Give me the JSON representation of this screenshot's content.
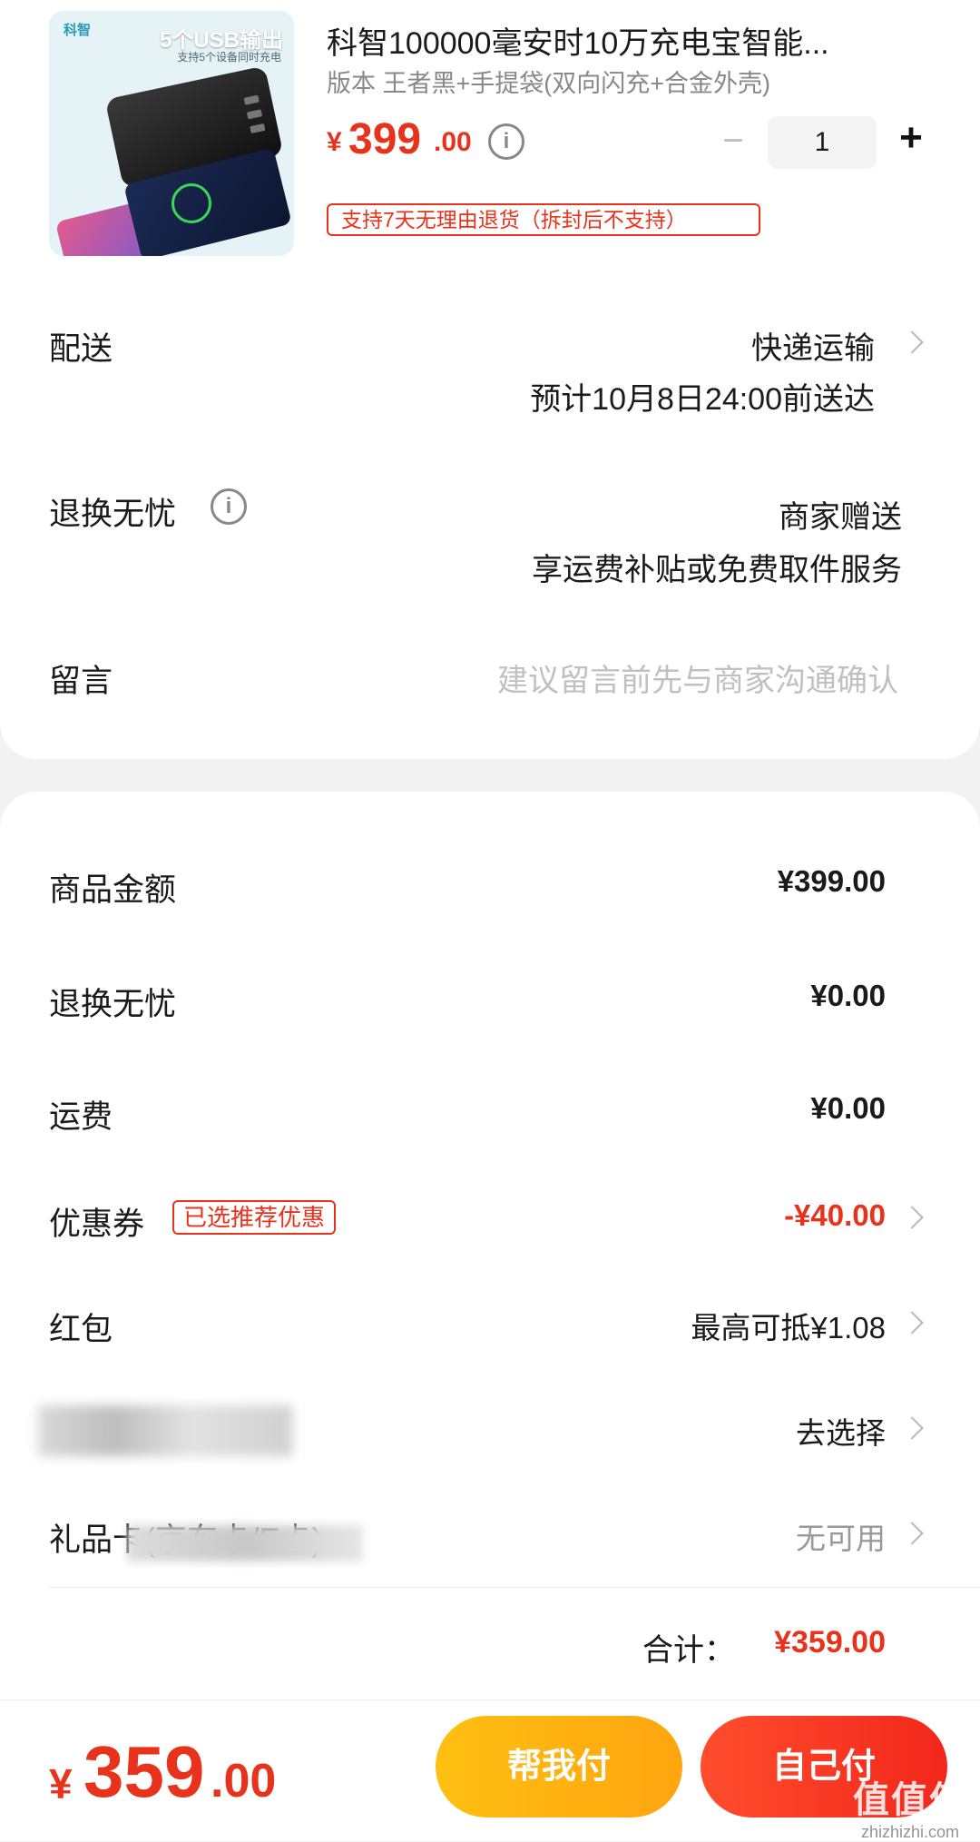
{
  "product": {
    "image_headline": "5个USB输出",
    "image_subline": "支持5个设备同时充电",
    "image_brand": "科智",
    "title": "科智100000毫安时10万充电宝智能...",
    "spec": "版本 王者黑+手提袋(双向闪充+合金外壳)",
    "price_symbol": "¥",
    "price_integer": "399",
    "price_decimal": ".00",
    "quantity": "1",
    "return_tag": "支持7天无理由退货（拆封后不支持）"
  },
  "delivery": {
    "label": "配送",
    "method": "快递运输",
    "eta": "预计10月8日24:00前送达"
  },
  "return_worry": {
    "label": "退换无忧",
    "line1": "商家赠送",
    "line2": "享运费补贴或免费取件服务"
  },
  "message": {
    "label": "留言",
    "placeholder": "建议留言前先与商家沟通确认"
  },
  "summary": {
    "goods_label": "商品金额",
    "goods_value": "¥399.00",
    "return_label": "退换无忧",
    "return_value": "¥0.00",
    "shipping_label": "运费",
    "shipping_value": "¥0.00",
    "coupon_label": "优惠券",
    "coupon_tag": "已选推荐优惠",
    "coupon_value": "-¥40.00",
    "redpacket_label": "红包",
    "redpacket_value": "最高可抵¥1.08",
    "blurred_value": "去选择",
    "giftcard_label": "礼品卡(京东卡/E卡)",
    "giftcard_value": "无可用",
    "total_label": "合计：",
    "total_value": "¥359.00"
  },
  "bottom": {
    "price_symbol": "¥",
    "price_integer": "359",
    "price_decimal": ".00",
    "help_pay": "帮我付",
    "self_pay": "自己付",
    "watermark": "值值值",
    "watermark_sub": "zhizhizhi.com"
  },
  "colors": {
    "accent_red": "#e8331c",
    "help_yellow": "#ffb30f"
  }
}
